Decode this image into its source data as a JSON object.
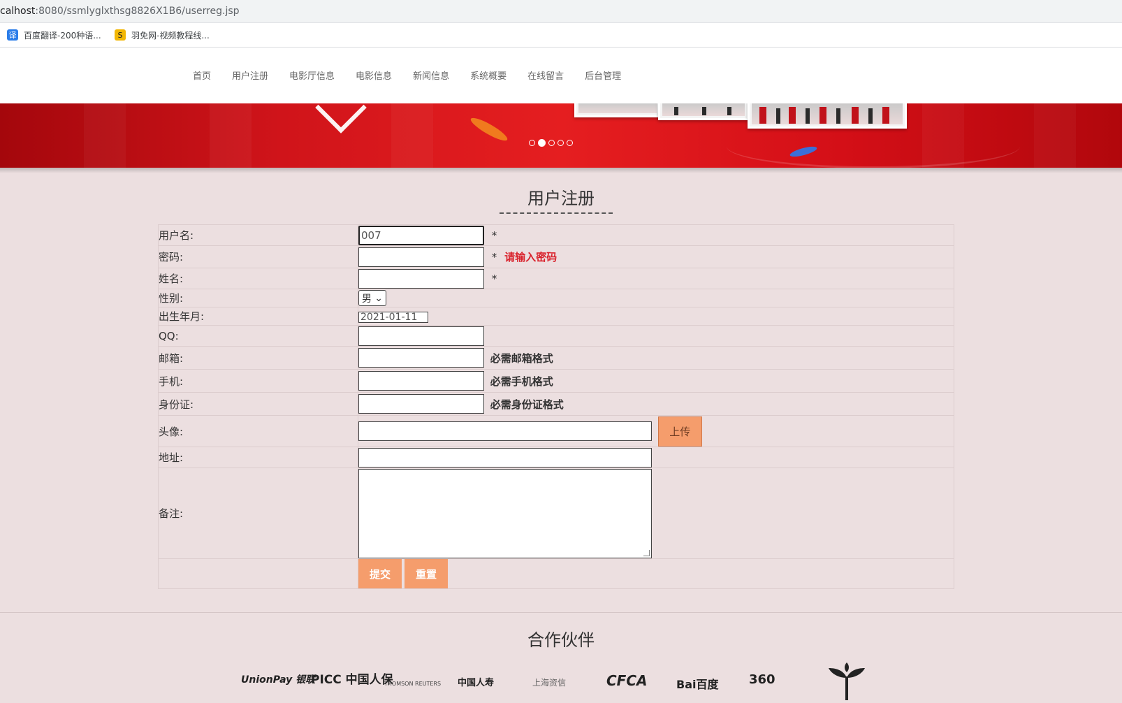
{
  "browser": {
    "url_host": "calhost",
    "url_rest": ":8080/ssmlyglxthsg8826X1B6/userreg.jsp",
    "bookmarks": [
      {
        "icon": "translate-icon",
        "glyph": "译",
        "label": "百度翻译-200种语..."
      },
      {
        "icon": "site-icon",
        "glyph": "S",
        "label": "羽免网-视频教程线..."
      }
    ]
  },
  "nav": {
    "items": [
      "首页",
      "用户注册",
      "电影厅信息",
      "电影信息",
      "新闻信息",
      "系统概要",
      "在线留言",
      "后台管理"
    ]
  },
  "banner": {
    "slide_count": 5,
    "active_index": 1
  },
  "form": {
    "title": "用户注册",
    "labels": {
      "username": "用户名:",
      "password": "密码:",
      "name": "姓名:",
      "gender": "性别:",
      "birth": "出生年月:",
      "qq": "QQ:",
      "email": "邮箱:",
      "phone": "手机:",
      "idcard": "身份证:",
      "avatar": "头像:",
      "address": "地址:",
      "remark": "备注:"
    },
    "values": {
      "username": "007",
      "gender": "男",
      "birth": "2021-01-11"
    },
    "required_mark": "*",
    "password_error": "请输入密码",
    "hints": {
      "email": "必需邮箱格式",
      "phone": "必需手机格式",
      "idcard": "必需身份证格式"
    },
    "buttons": {
      "upload": "上传",
      "submit": "提交",
      "reset": "重置"
    }
  },
  "partners": {
    "title": "合作伙伴",
    "logos": [
      "UnionPay 银联",
      "PICC 中国人保",
      "THOMSON REUTERS",
      "中国人寿",
      "上海资信",
      "CFCA",
      "Bai百度",
      "360",
      "leaf-logo"
    ]
  },
  "colors": {
    "page_bg": "#ecdfe0",
    "accent_button": "#f59d6c",
    "error_text": "#d9232d",
    "banner_red": "#d0141a"
  }
}
